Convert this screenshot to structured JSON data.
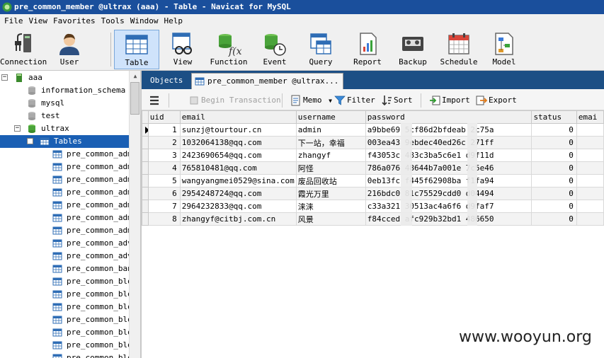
{
  "window": {
    "title": "pre_common_member @ultrax (aaa) - Table - Navicat for MySQL"
  },
  "menu": [
    "File",
    "View",
    "Favorites",
    "Tools",
    "Window",
    "Help"
  ],
  "toolbar": {
    "items": [
      {
        "label": "Connection",
        "icon": "connection-icon"
      },
      {
        "label": "User",
        "icon": "user-icon"
      },
      {
        "label": "Table",
        "icon": "table-icon",
        "active": true
      },
      {
        "label": "View",
        "icon": "view-icon"
      },
      {
        "label": "Function",
        "icon": "function-icon"
      },
      {
        "label": "Event",
        "icon": "event-icon"
      },
      {
        "label": "Query",
        "icon": "query-icon"
      },
      {
        "label": "Report",
        "icon": "report-icon"
      },
      {
        "label": "Backup",
        "icon": "backup-icon"
      },
      {
        "label": "Schedule",
        "icon": "schedule-icon"
      },
      {
        "label": "Model",
        "icon": "model-icon"
      }
    ]
  },
  "tree": {
    "connection": "aaa",
    "databases": [
      "information_schema",
      "mysql",
      "test",
      "ultrax"
    ],
    "tables_label": "Tables",
    "tables": [
      "pre_common_adm",
      "pre_common_adm",
      "pre_common_adm",
      "pre_common_adm",
      "pre_common_adm",
      "pre_common_adm",
      "pre_common_adm",
      "pre_common_adv",
      "pre_common_adv",
      "pre_common_ban",
      "pre_common_blo",
      "pre_common_blo",
      "pre_common_blo",
      "pre_common_blo",
      "pre_common_blo",
      "pre_common_blo",
      "pre_common_blo"
    ]
  },
  "tabs": {
    "objects": "Objects",
    "active": "pre_common_member @ultrax..."
  },
  "grid_toolbar": {
    "begin_transaction": "Begin Transaction",
    "memo": "Memo",
    "filter": "Filter",
    "sort": "Sort",
    "import": "Import",
    "export": "Export"
  },
  "grid": {
    "columns": [
      "uid",
      "email",
      "username",
      "password",
      "status",
      "emai"
    ],
    "rows": [
      {
        "uid": "1",
        "email": "sunzj@tourtour.cn",
        "username": "admin",
        "password": "a9bbe69  5cf86d2bfdeab  2c75a",
        "status": "0"
      },
      {
        "uid": "2",
        "email": "1032064138@qq.com",
        "username": "下一站，幸福",
        "password": "003ea43  9ebdec40ed26c  271ff",
        "status": "0"
      },
      {
        "uid": "3",
        "email": "2423690654@qq.com",
        "username": "zhangyf",
        "password": "f43053c  483c3ba5c6e1  d9f11d",
        "status": "0"
      },
      {
        "uid": "4",
        "email": "765810481@qq.com",
        "username": "阿怪",
        "password": "786a076  48644b7a001e  7c5e46",
        "status": "0"
      },
      {
        "uid": "5",
        "email": "wangyangmei0529@sina.com",
        "username": "废品回收站",
        "password": "0eb13fc  f445f62908ba  f1fa94",
        "status": "0"
      },
      {
        "uid": "6",
        "email": "2954248724@qq.com",
        "username": "霞光万里",
        "password": "216bdc0  81c75529cdd0  d04494",
        "status": "0"
      },
      {
        "uid": "7",
        "email": "2964232833@qq.com",
        "username": "涞涞",
        "password": "c33a321  30513ac4a6f6  d9faf7",
        "status": "0"
      },
      {
        "uid": "8",
        "email": "zhangyf@citbj.com.cn",
        "username": "风景",
        "password": "f84cced  afc929b32bd1  486650",
        "status": "0"
      }
    ]
  },
  "watermark": "www.wooyun.org"
}
